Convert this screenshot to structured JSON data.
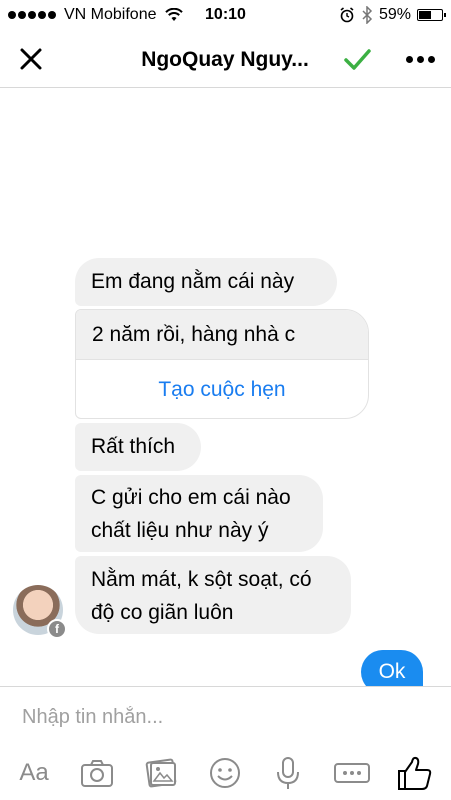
{
  "status": {
    "carrier": "VN Mobifone",
    "time": "10:10",
    "battery": "59%",
    "battery_level": 0.59
  },
  "header": {
    "title": "NgoQuay Nguy..."
  },
  "messages": {
    "m1": "Em đang nằm cái này",
    "card_text": "2 năm rồi, hàng nhà c",
    "card_action": "Tạo cuộc hẹn",
    "m3": "Rất thích",
    "m4_line1": "C gửi cho em cái nào",
    "m4_line2": "chất liệu như này ý",
    "m5_line1": "Nằm mát, k sột soạt, có",
    "m5_line2": "độ co giãn luôn",
    "sent": "Ok"
  },
  "composer": {
    "placeholder": "Nhập tin nhắn...",
    "text_button": "Aa"
  },
  "colors": {
    "accent": "#1a8cf0",
    "link": "#1a7df0",
    "check": "#3cb043",
    "incoming_bubble": "#f0f0f0",
    "icon_gray": "#8b8b8b"
  }
}
